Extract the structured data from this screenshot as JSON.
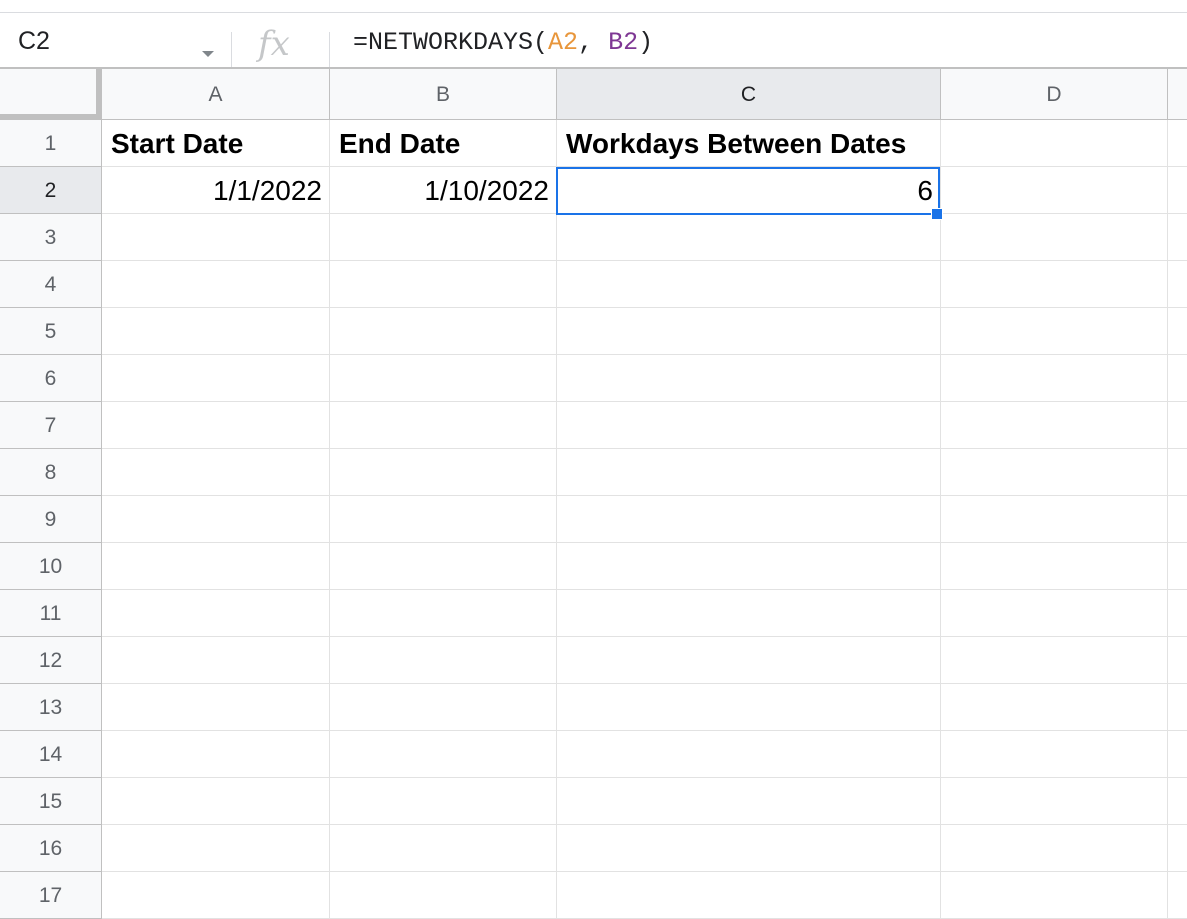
{
  "formula_bar": {
    "name_box": "C2",
    "fx_icon": "fx-icon",
    "formula_parts": [
      {
        "text": "=NETWORKDAYS(",
        "color": "#202124"
      },
      {
        "text": "A2",
        "color": "#e8963b"
      },
      {
        "text": ", ",
        "color": "#202124"
      },
      {
        "text": "B2",
        "color": "#7e3794"
      },
      {
        "text": ")",
        "color": "#202124"
      }
    ]
  },
  "columns": [
    "A",
    "B",
    "C",
    "D"
  ],
  "rows": [
    "1",
    "2",
    "3",
    "4",
    "5",
    "6",
    "7",
    "8",
    "9",
    "10",
    "11",
    "12",
    "13",
    "14",
    "15",
    "16",
    "17"
  ],
  "cells": {
    "A1": "Start Date",
    "B1": "End Date",
    "C1": "Workdays Between Dates",
    "A2": "1/1/2022",
    "B2": "1/10/2022",
    "C2": "6"
  },
  "selected_cell": "C2",
  "colors": {
    "selection": "#1a73e8",
    "header_bg": "#f8f9fa",
    "header_selected_bg": "#e8eaed"
  }
}
